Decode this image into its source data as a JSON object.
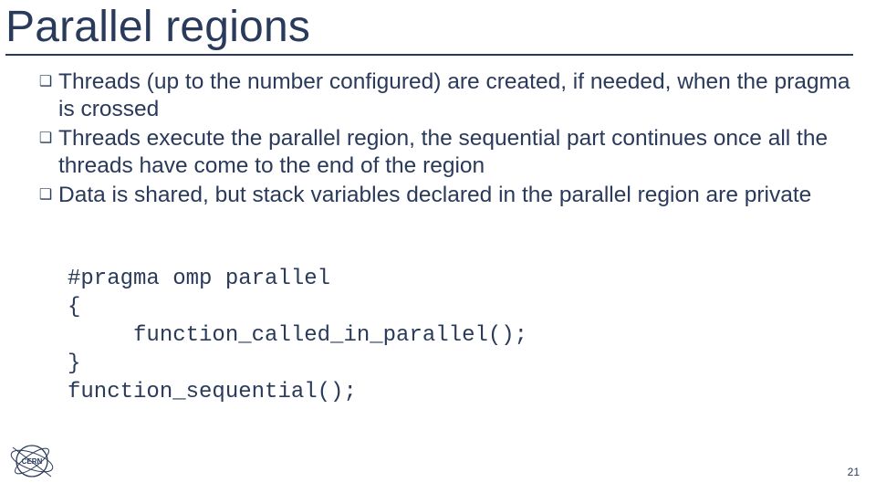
{
  "title": "Parallel regions",
  "bullets": [
    "Threads (up to the number configured) are created, if needed, when the pragma is crossed",
    "Threads execute the parallel region, the sequential part continues once all the threads have come to the end of the region",
    "Data is shared, but stack variables declared in the parallel region are private"
  ],
  "code": {
    "l0": "#pragma omp parallel",
    "l1": "{",
    "l2": "     function_called_in_parallel();",
    "l3": "}",
    "l4": "function_sequential();"
  },
  "page_number": "21",
  "logo_label": "CERN"
}
